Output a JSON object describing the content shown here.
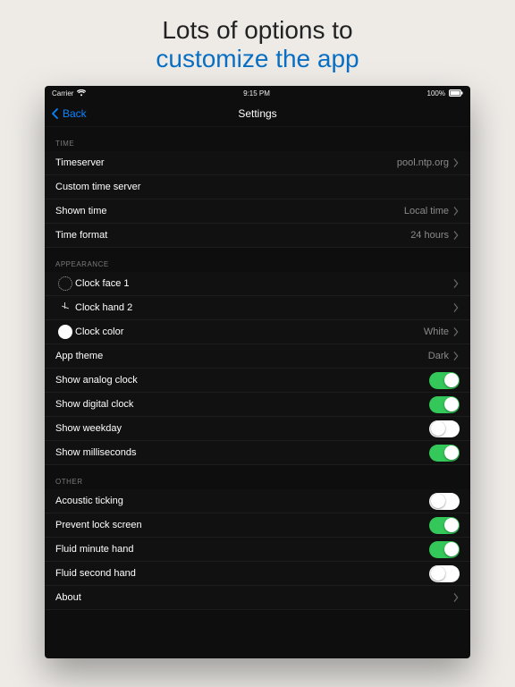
{
  "promo": {
    "line1": "Lots of options to",
    "line2": "customize the app"
  },
  "statusbar": {
    "carrier": "Carrier",
    "time": "9:15 PM",
    "battery": "100%"
  },
  "nav": {
    "back": "Back",
    "title": "Settings"
  },
  "sections": {
    "time": {
      "header": "TIME",
      "timeserver": {
        "label": "Timeserver",
        "value": "pool.ntp.org"
      },
      "custom": {
        "label": "Custom time server",
        "value": ""
      },
      "shown": {
        "label": "Shown time",
        "value": "Local time"
      },
      "format": {
        "label": "Time format",
        "value": "24 hours"
      }
    },
    "appearance": {
      "header": "APPEARANCE",
      "face": {
        "label": "Clock face 1"
      },
      "hand": {
        "label": "Clock hand 2"
      },
      "color": {
        "label": "Clock color",
        "value": "White"
      },
      "theme": {
        "label": "App theme",
        "value": "Dark"
      },
      "analog": {
        "label": "Show analog clock",
        "on": true
      },
      "digital": {
        "label": "Show digital clock",
        "on": true
      },
      "weekday": {
        "label": "Show weekday",
        "on": false
      },
      "ms": {
        "label": "Show milliseconds",
        "on": true
      }
    },
    "other": {
      "header": "OTHER",
      "tick": {
        "label": "Acoustic ticking",
        "on": false
      },
      "lock": {
        "label": "Prevent lock screen",
        "on": true
      },
      "fminute": {
        "label": "Fluid minute hand",
        "on": true
      },
      "fsecond": {
        "label": "Fluid second hand",
        "on": false
      },
      "about": {
        "label": "About"
      }
    }
  }
}
